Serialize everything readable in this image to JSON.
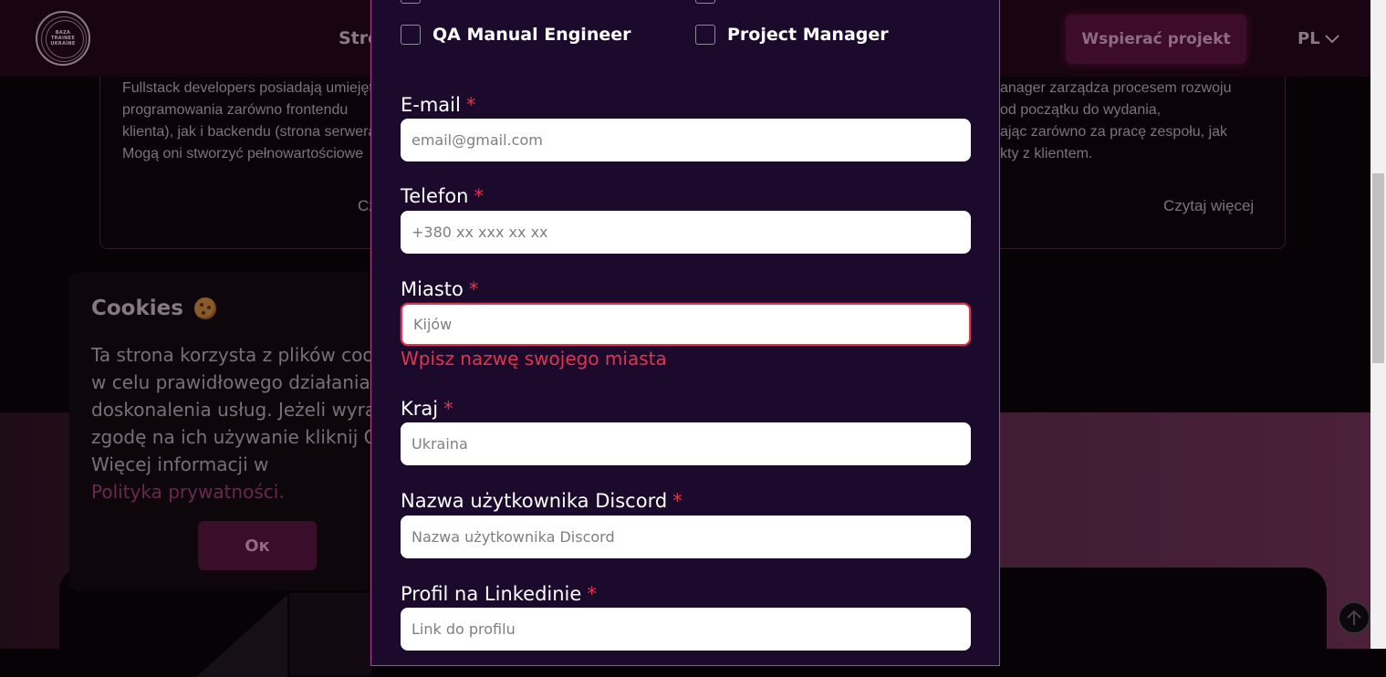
{
  "header": {
    "logo_lines": [
      "BAZA",
      "TRAINEE",
      "UKRAINE"
    ],
    "nav_partial": "Stro",
    "support_button": "Wspierać projekt",
    "language": "PL"
  },
  "cards": {
    "left_text": "Fullstack developers posiadają umiejętności\nprogramowania zarówno frontendu\nklienta), jak i backendu (strona serwera).\nMogą oni stworzyć pełnowartościowe",
    "left_read_more": "Cz",
    "right_text": "anager zarządza procesem rozwoju\nod początku do wydania,\nając zarówno za pracę zespołu, jak\nkty z klientem.",
    "right_read_more": "Czytaj więcej"
  },
  "cookies": {
    "title": "Cookies",
    "body": "Ta strona korzysta z plików cookies\nw celu prawidłowego działania i\ndoskonalenia usług. Jeżeli wyrażasz\nzgodę na ich używanie kliknij OK.\nWięcej informacji w",
    "link": "Polityka prywatności.",
    "ok_button": "Ок"
  },
  "modal": {
    "checkboxes": [
      {
        "label": "QA Manual Engineer",
        "checked": false
      },
      {
        "label": "Project Manager",
        "checked": false
      }
    ],
    "fields": {
      "email": {
        "label": "E-mail",
        "required_mark": "*",
        "placeholder": "email@gmail.com",
        "value": ""
      },
      "phone": {
        "label": "Telefon",
        "required_mark": "*",
        "placeholder": "+380 xx xxx xx xx",
        "value": ""
      },
      "city": {
        "label": "Miasto",
        "required_mark": "*",
        "placeholder": "Kijów",
        "value": "",
        "error": "Wpisz nazwę swojego miasta"
      },
      "country": {
        "label": "Kraj",
        "required_mark": "*",
        "placeholder": "Ukraina",
        "value": ""
      },
      "discord": {
        "label": "Nazwa użytkownika Discord",
        "required_mark": "*",
        "placeholder": "Nazwa użytkownika Discord",
        "value": ""
      },
      "linkedin": {
        "label": "Profil na Linkedinie",
        "required_mark": "*",
        "placeholder": "Link do profilu",
        "value": ""
      }
    }
  },
  "colors": {
    "modal_bg": "#1c0a2c",
    "modal_border": "#b4449b",
    "error": "#e0354f",
    "accent": "#3c0c2a"
  },
  "icons": {
    "cookie": "cookie-icon",
    "language_chevron": "chevron-down-icon",
    "scroll_top": "arrow-up-icon"
  }
}
